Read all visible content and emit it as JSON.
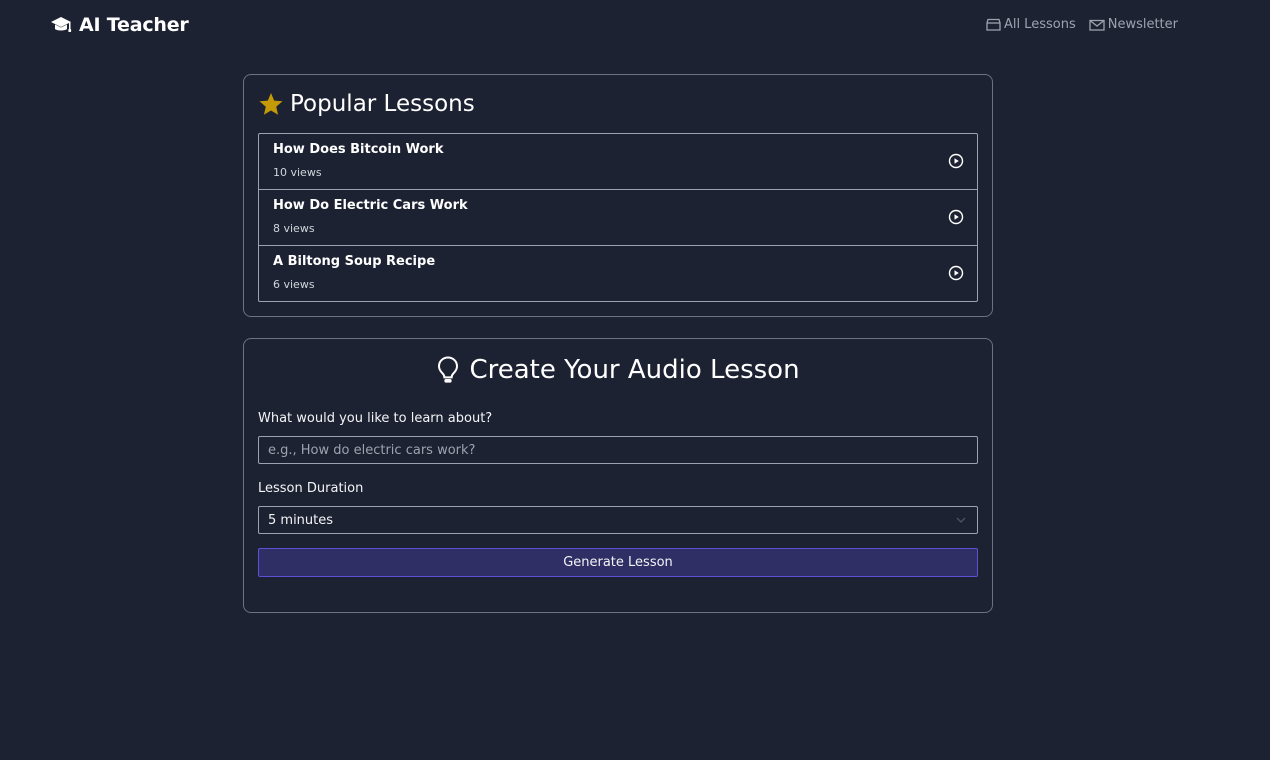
{
  "brand": {
    "name": "AI Teacher",
    "icon": "graduation-cap-icon"
  },
  "nav": {
    "all_lessons": {
      "label": "All Lessons",
      "icon": "archive-icon"
    },
    "newsletter": {
      "label": "Newsletter",
      "icon": "envelope-icon"
    }
  },
  "popular": {
    "title": "Popular Lessons",
    "icon": "star-icon",
    "lessons": [
      {
        "title": "How Does Bitcoin Work",
        "views": "10 views"
      },
      {
        "title": "How Do Electric Cars Work",
        "views": "8 views"
      },
      {
        "title": "A Biltong Soup Recipe",
        "views": "6 views"
      }
    ]
  },
  "create": {
    "title": "Create Your Audio Lesson",
    "icon": "lightbulb-icon",
    "topic_label": "What would you like to learn about?",
    "topic_placeholder": "e.g., How do electric cars work?",
    "topic_value": "",
    "duration_label": "Lesson Duration",
    "duration_value": "5 minutes",
    "generate_label": "Generate Lesson"
  },
  "colors": {
    "background": "#1d2232",
    "star": "#c49a07",
    "button": "#2f2f66",
    "button_border": "#5b52d6"
  }
}
